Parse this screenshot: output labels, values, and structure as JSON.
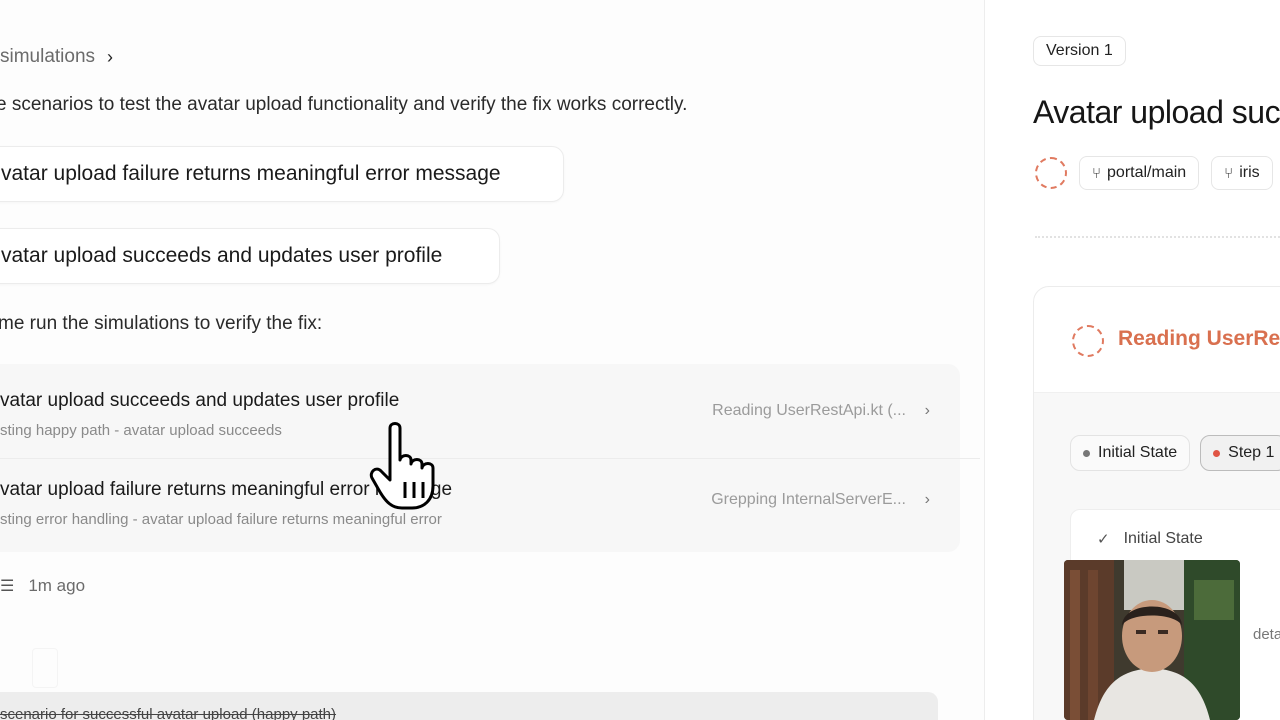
{
  "left": {
    "breadcrumb": "simulations",
    "intro": "e scenarios to test the avatar upload functionality and verify the fix works correctly.",
    "scenarios": [
      "vatar upload failure returns meaningful error message",
      "vatar upload succeeds and updates user profile"
    ],
    "run_line": "me run the simulations to verify the fix:",
    "simulations": [
      {
        "title": "vatar upload succeeds and updates user profile",
        "subtitle": "sting happy path - avatar upload succeeds",
        "status": "Reading UserRestApi.kt (..."
      },
      {
        "title": "vatar upload failure returns meaningful error message",
        "subtitle": "sting error handling - avatar upload failure returns meaningful error",
        "status": "Grepping InternalServerE..."
      }
    ],
    "meta_time": "1m ago",
    "bottom_text": "scenario for successful avatar upload (happy path)"
  },
  "right": {
    "version": "Version 1",
    "title": "Avatar upload suc",
    "tags": [
      "portal/main",
      "iris"
    ],
    "reading": "Reading UserRe",
    "state_tabs": [
      "Initial State",
      "Step 1"
    ],
    "inner_state": "Initial State",
    "details": "details"
  },
  "colors": {
    "accent": "#d9704f",
    "step_dot": "#e05545",
    "initial_dot": "#777777"
  }
}
